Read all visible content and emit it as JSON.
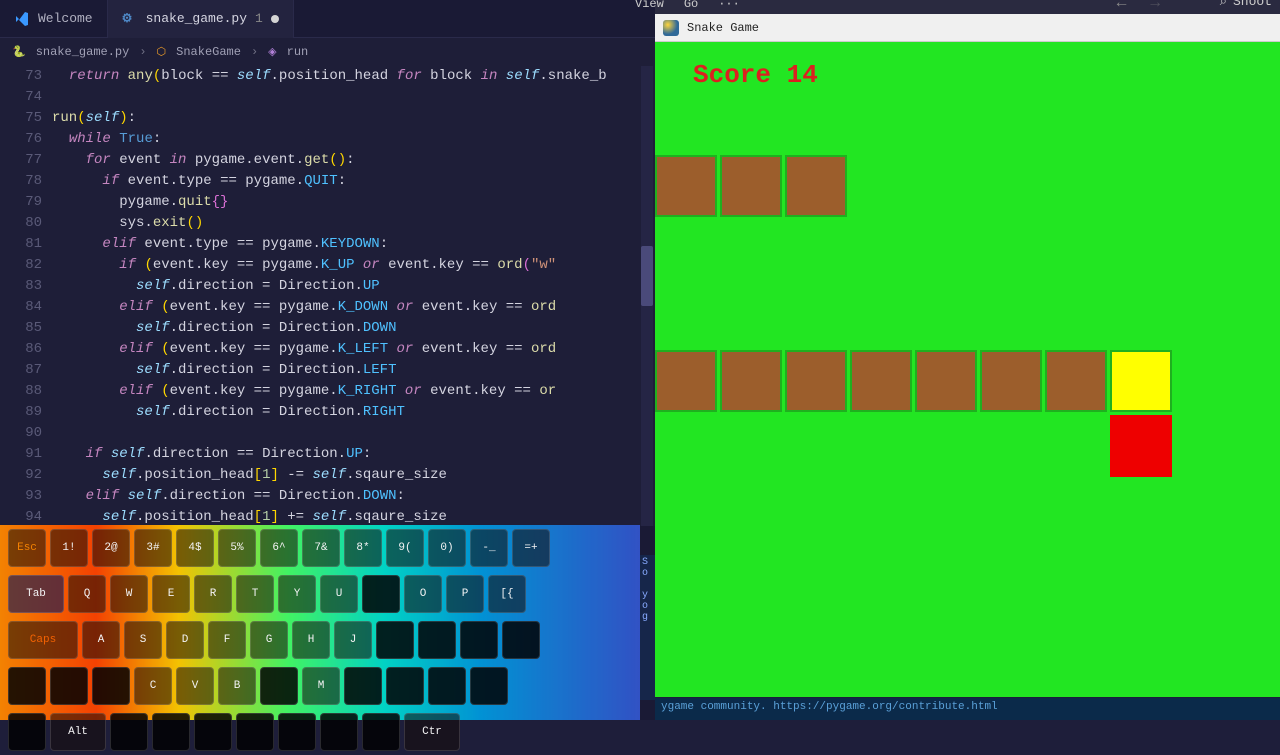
{
  "tabs": [
    {
      "label": "Welcome",
      "icon": "vscode"
    },
    {
      "label": "snake_game.py",
      "icon": "python",
      "badge": "1",
      "dirty": true
    }
  ],
  "breadcrumbs": {
    "file": "snake_game.py",
    "class": "SnakeGame",
    "method": "run"
  },
  "editor": {
    "lines_start": 73,
    "lines": [
      {
        "n": 73,
        "html": "  <span class='kw'>return</span> <span class='fn'>any</span><span class='par'>(</span>block <span class='op'>==</span> <span class='self'>self</span>.position_head <span class='kw'>for</span> block <span class='kw'>in</span> <span class='self'>self</span>.snake_b"
      },
      {
        "n": 74,
        "html": ""
      },
      {
        "n": 75,
        "html": "<span class='fn'>run</span><span class='par'>(</span><span class='self'>self</span><span class='par'>)</span>:"
      },
      {
        "n": 76,
        "html": "  <span class='kw'>while</span> <span class='kw2'>True</span>:"
      },
      {
        "n": 77,
        "html": "    <span class='kw'>for</span> event <span class='kw'>in</span> pygame.event.<span class='fn'>get</span><span class='par'>()</span>:"
      },
      {
        "n": 78,
        "html": "      <span class='kw'>if</span> event.type <span class='op'>==</span> pygame.<span class='const'>QUIT</span>:"
      },
      {
        "n": 79,
        "html": "        pygame.<span class='fn'>quit</span><span class='par2'>{}</span>"
      },
      {
        "n": 80,
        "html": "        sys.<span class='fn'>exit</span><span class='par'>()</span>"
      },
      {
        "n": 81,
        "html": "      <span class='kw'>elif</span> event.type <span class='op'>==</span> pygame.<span class='const'>KEYDOWN</span>:"
      },
      {
        "n": 82,
        "html": "        <span class='kw'>if</span> <span class='par'>(</span>event.key <span class='op'>==</span> pygame.<span class='const'>K_UP</span> <span class='kw'>or</span> event.key <span class='op'>==</span> <span class='fn'>ord</span><span class='par2'>(</span><span class='str'>\"w\"</span>"
      },
      {
        "n": 83,
        "html": "          <span class='self'>self</span>.direction <span class='op'>=</span> Direction.<span class='const'>UP</span>"
      },
      {
        "n": 84,
        "html": "        <span class='kw'>elif</span> <span class='par'>(</span>event.key <span class='op'>==</span> pygame.<span class='const'>K_DOWN</span> <span class='kw'>or</span> event.key <span class='op'>==</span> <span class='fn'>ord</span>"
      },
      {
        "n": 85,
        "html": "          <span class='self'>self</span>.direction <span class='op'>=</span> Direction.<span class='const'>DOWN</span>"
      },
      {
        "n": 86,
        "html": "        <span class='kw'>elif</span> <span class='par'>(</span>event.key <span class='op'>==</span> pygame.<span class='const'>K_LEFT</span> <span class='kw'>or</span> event.key <span class='op'>==</span> <span class='fn'>ord</span>"
      },
      {
        "n": 87,
        "html": "          <span class='self'>self</span>.direction <span class='op'>=</span> Direction.<span class='const'>LEFT</span>"
      },
      {
        "n": 88,
        "html": "        <span class='kw'>elif</span> <span class='par'>(</span>event.key <span class='op'>==</span> pygame.<span class='const'>K_RIGHT</span> <span class='kw'>or</span> event.key <span class='op'>==</span> <span class='fn'>or</span>"
      },
      {
        "n": 89,
        "html": "          <span class='self'>self</span>.direction <span class='op'>=</span> Direction.<span class='const'>RIGHT</span>"
      },
      {
        "n": 90,
        "html": ""
      },
      {
        "n": 91,
        "html": "    <span class='kw'>if</span> <span class='self'>self</span>.direction <span class='op'>==</span> Direction.<span class='const'>UP</span>:"
      },
      {
        "n": 92,
        "html": "      <span class='self'>self</span>.position_head<span class='par'>[</span><span class='num'>1</span><span class='par'>]</span> <span class='op'>-=</span> <span class='self'>self</span>.sqaure_size"
      },
      {
        "n": 93,
        "html": "    <span class='kw'>elif</span> <span class='self'>self</span>.direction <span class='op'>==</span> Direction.<span class='const'>DOWN</span>:"
      },
      {
        "n": 94,
        "html": "      <span class='self'>self</span>.position_head<span class='par'>[</span><span class='num'>1</span><span class='par'>]</span> <span class='op'>+=</span> <span class='self'>self</span>.sqaure_size"
      }
    ]
  },
  "keyboard": {
    "row0": [
      "Esc",
      "1!",
      "2@",
      "3#",
      "4$",
      "5%",
      "6^",
      "7&",
      "8*",
      "9(",
      "0)",
      "-_",
      "=+"
    ],
    "row1": [
      "Tab",
      "Q",
      "W",
      "E",
      "R",
      "T",
      "Y",
      "U",
      "",
      "O",
      "P",
      "[{"
    ],
    "row2": [
      "Caps",
      "A",
      "S",
      "D",
      "F",
      "G",
      "H",
      "J",
      "",
      "",
      "",
      ""
    ],
    "row3": [
      "",
      "",
      "",
      "C",
      "V",
      "B",
      "",
      "M",
      "",
      "",
      "",
      ""
    ],
    "row4": [
      "",
      "Alt",
      "",
      "",
      "",
      "",
      "",
      "",
      "",
      "Ctr"
    ]
  },
  "game": {
    "menubar_partial": [
      "View",
      "Go",
      "···"
    ],
    "shoot_label": "Shoot",
    "title": "Snake Game",
    "score_label": "Score",
    "score_value": 14,
    "cell": 65,
    "snake_body_top": [
      [
        0,
        1
      ],
      [
        1,
        1
      ],
      [
        2,
        1
      ]
    ],
    "snake_body_mid": [
      [
        0,
        4
      ],
      [
        1,
        4
      ],
      [
        2,
        4
      ],
      [
        3,
        4
      ],
      [
        4,
        4
      ],
      [
        5,
        4
      ],
      [
        6,
        4
      ]
    ],
    "head": [
      7,
      4
    ],
    "food": [
      7,
      5
    ]
  },
  "terminal_footer": "ygame community. https://pygame.org/contribute.html"
}
